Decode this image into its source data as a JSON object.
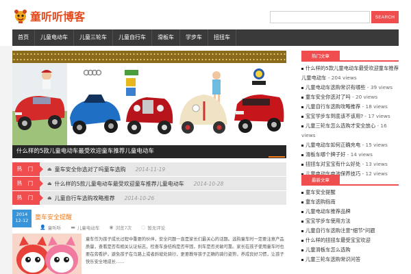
{
  "site": {
    "logo_text": "童听听博客"
  },
  "search": {
    "placeholder": "",
    "button_label": "SEARCH"
  },
  "nav": {
    "items": [
      "首页",
      "儿童电动车",
      "儿童三轮车",
      "儿童自行车",
      "滑板车",
      "学步车",
      "扭扭车"
    ]
  },
  "slider": {
    "caption": "什么样的5款儿童电动车最受欢迎童车推荐儿童电动车"
  },
  "hot": {
    "tag_label": "热 门",
    "rows": [
      {
        "title": "童车安全你选对了吗童车选购",
        "date": "2014-11-19"
      },
      {
        "title": "什么样的5款儿童电动车最受欢迎童车推荐儿童电动车",
        "date": "2014-10-28"
      },
      {
        "title": "儿童自行车选购攻略推荐",
        "date": "2014-10-26"
      }
    ]
  },
  "post": {
    "date_year": "2014",
    "date_day": "12-12",
    "title": "童车安全提醒",
    "meta_author": "童听听",
    "meta_category": "儿童电动车",
    "meta_views": "浏览7次",
    "meta_comments": "暂无评论",
    "excerpt": "童车作为孩子成长过程中重要的伙伴，安全问题一直是家长们最关心的话题。选购童车时一定要注意产品质量，查看是否有相关认证标志，检查车身结构是否牢固，刹车是否灵敏可靠。家长在孩子使用童车时也要在旁看护，避免孩子在马路上或者斜坡处骑行，更要教导孩子正确的骑行姿势，养成良好习惯，让孩子快乐安全地成长……"
  },
  "sidebar": {
    "popular": {
      "title": "热门文章",
      "items": [
        {
          "title": "什么样的5款儿童电动车最受欢迎童车推荐儿童电动车",
          "views": "- 204 views"
        },
        {
          "title": "儿童电动车选购常识有哪些",
          "views": "- 39 views"
        },
        {
          "title": "童车安全你选对了吗",
          "views": "- 20 views"
        },
        {
          "title": "儿童自行车选购攻略推荐",
          "views": "- 18 views"
        },
        {
          "title": "宝宝学步车到底该不该用?",
          "views": "- 17 views"
        },
        {
          "title": "儿童三轮车怎么选购才安全放心",
          "views": "- 16 views"
        },
        {
          "title": "儿童电动车如何正确充电",
          "views": "- 15 views"
        },
        {
          "title": "滑板车哪个牌子好",
          "views": "- 14 views"
        },
        {
          "title": "扭扭车对宝宝有什么好处",
          "views": "- 13 views"
        },
        {
          "title": "儿童电动车电池保养技巧",
          "views": "- 12 views"
        }
      ]
    },
    "latest": {
      "title": "最新文章",
      "items": [
        "童车安全提醒",
        "童车选购指南",
        "儿童电动车推荐品牌",
        "宝宝学步车使用方法",
        "儿童自行车选购注意\"细节\"问题",
        "什么样的扭扭车最受宝宝欢迎",
        "儿童滑板车怎么选购",
        "儿童三轮车选购常识问答"
      ]
    }
  }
}
